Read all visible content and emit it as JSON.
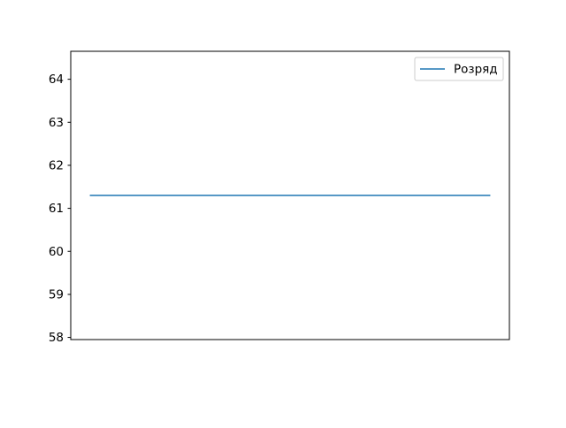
{
  "chart_data": {
    "type": "line",
    "title": "",
    "xlabel": "",
    "ylabel": "",
    "x": [
      0,
      1
    ],
    "series": [
      {
        "name": "Розряд",
        "values": [
          61.3,
          61.3
        ],
        "color": "#1f77b4"
      }
    ],
    "ylim": [
      57.95,
      64.65
    ],
    "yticks": [
      58,
      59,
      60,
      61,
      62,
      63,
      64
    ],
    "xticks": [],
    "grid": false,
    "legend_position": "upper right"
  }
}
